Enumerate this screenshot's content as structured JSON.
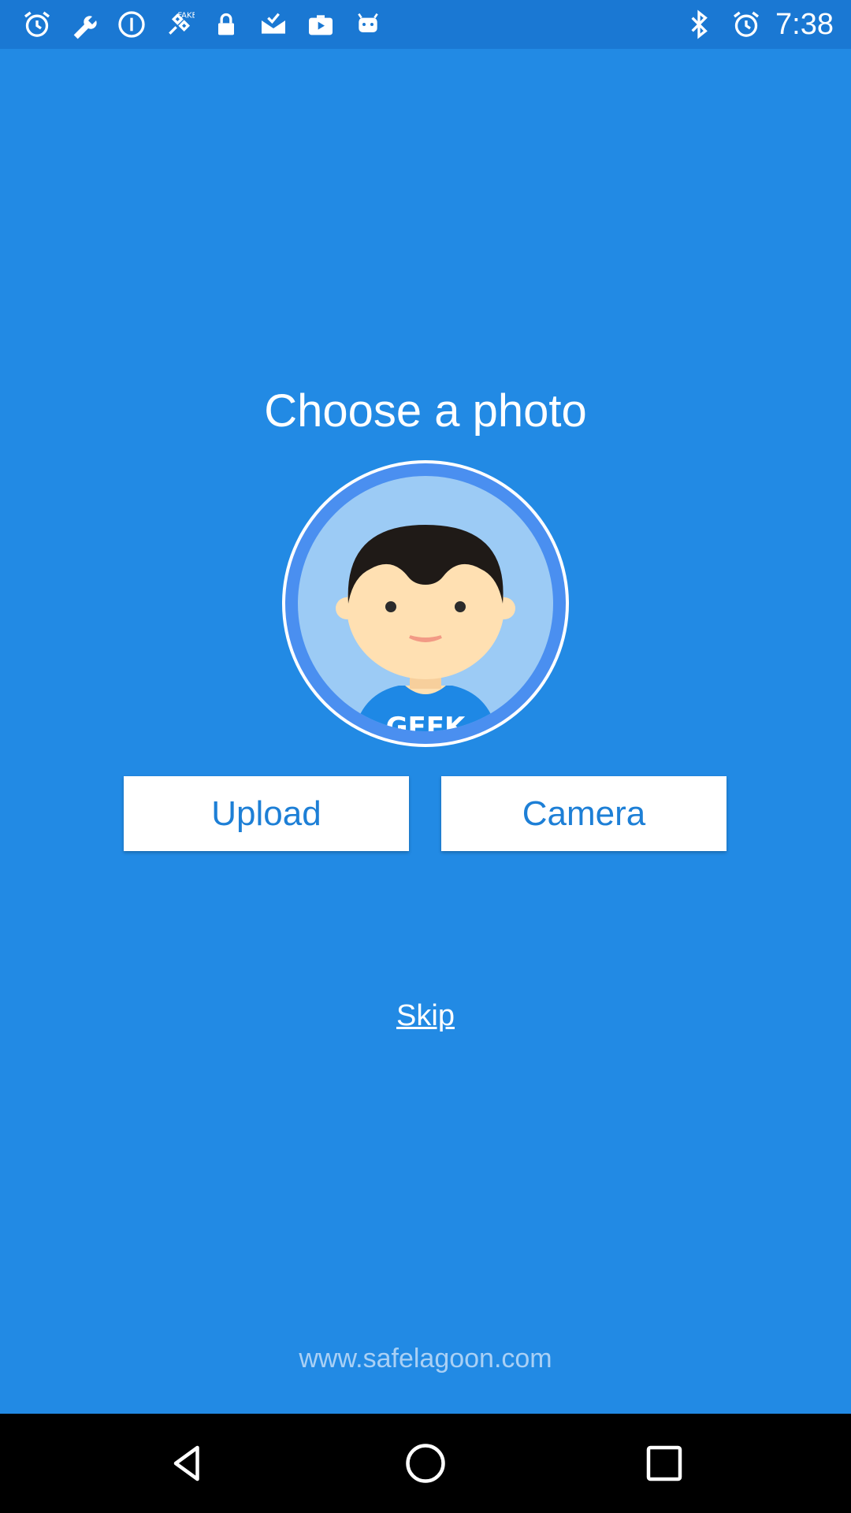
{
  "status_bar": {
    "time": "7:38",
    "left_icons": [
      "alarm-icon",
      "wrench-icon",
      "info-icon",
      "satellite-icon",
      "lock-icon",
      "mail-check-icon",
      "play-store-icon",
      "android-icon"
    ],
    "right_icons": [
      "bluetooth-icon",
      "alarm-icon"
    ],
    "fake_gps_badge": "FAKE"
  },
  "main": {
    "title": "Choose a photo",
    "avatar_shirt_text": "GEEK",
    "upload_label": "Upload",
    "camera_label": "Camera",
    "skip_label": "Skip",
    "website": "www.safelagoon.com"
  },
  "colors": {
    "background": "#228ae4",
    "status_bar": "#1a78d3",
    "button_text": "#1d7fd6",
    "website_text": "#a9d0f5"
  },
  "nav_bar": {
    "buttons": [
      "back-icon",
      "home-icon",
      "recents-icon"
    ]
  }
}
